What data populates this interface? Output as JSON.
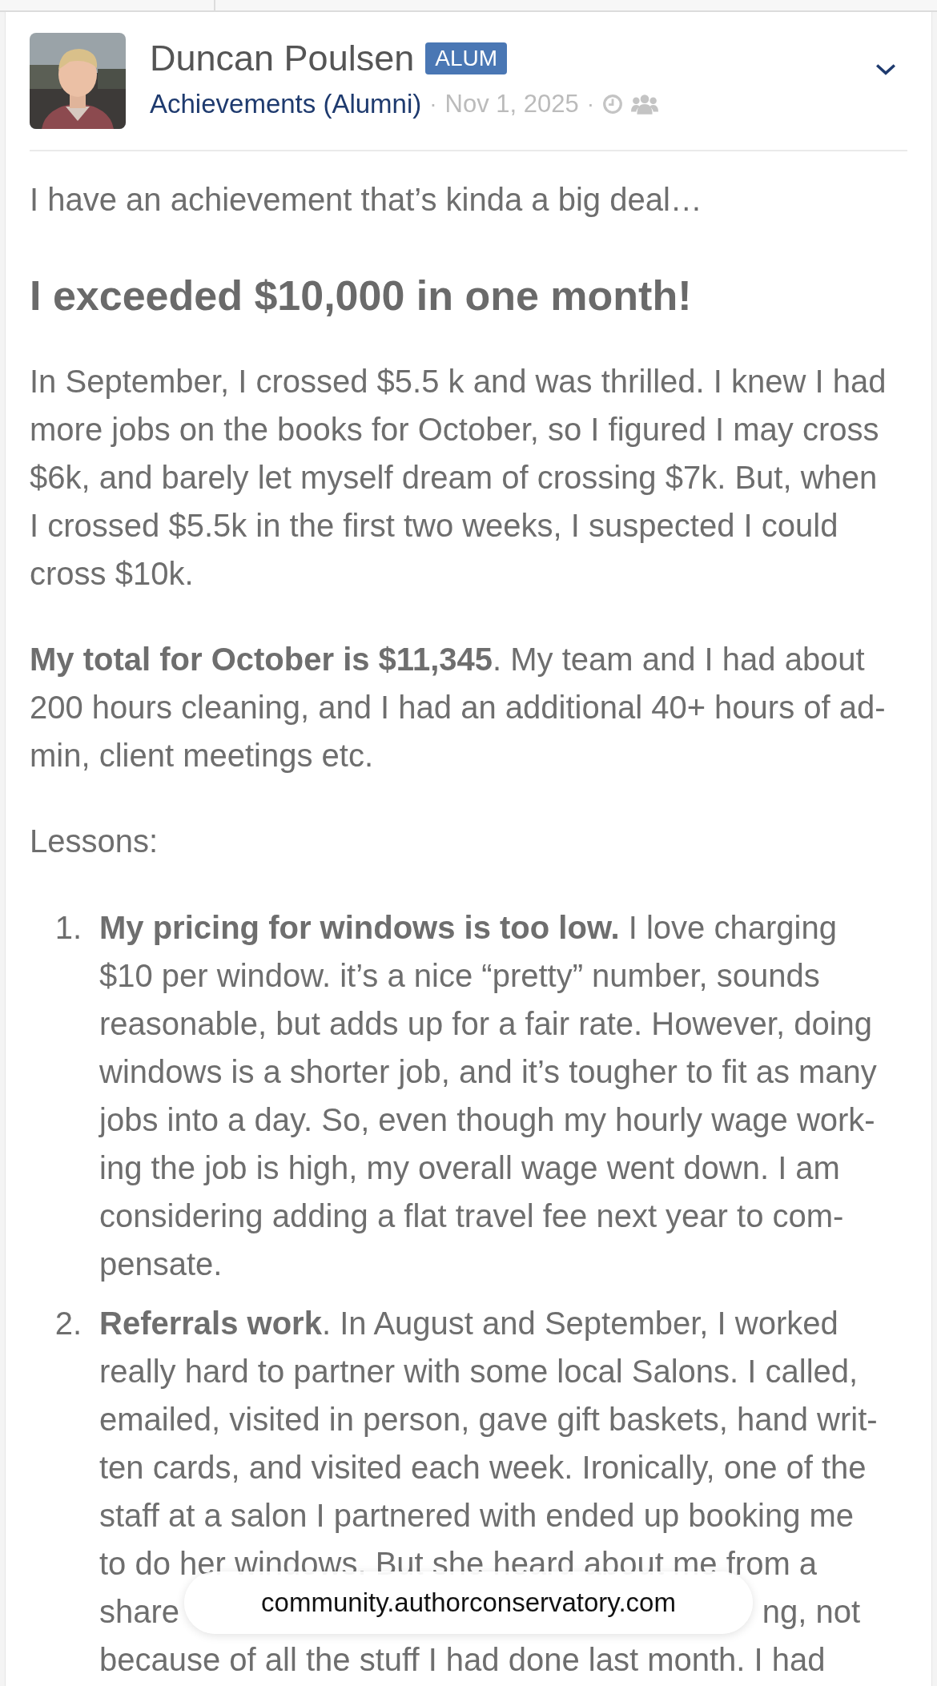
{
  "post": {
    "author": "Duncan Poulsen",
    "badge": "ALUM",
    "category": "Achievements (Alumni)",
    "date": "Nov 1, 2025",
    "intro": "I have an achievement that’s kinda a big deal…",
    "heading": "I exceeded $10,000 in one month!",
    "paragraphs": [
      [
        "In September, I crossed $5.5 k and was thrilled. I knew I had",
        "more jobs on the books for October, so I figured I may cross",
        "$6k, and barely let myself dream of crossing $7k. But, when",
        "I crossed $5.5k in the first two weeks, I suspected I could",
        "cross $10k."
      ],
      [
        "**My total for October is $11,345**. My team and I had about",
        "200 hours cleaning, and I had an additional 40+ hours of ad-",
        "min, client meetings etc."
      ],
      [
        "Lessons:"
      ]
    ],
    "lessons": [
      {
        "number": "1.",
        "lines": [
          "**My pricing for windows is too low.** I love charging",
          "$10 per window. it’s a nice “pretty” number, sounds",
          "reasonable, but adds up for a fair rate. However, doing",
          "windows is a shorter job, and it’s tougher to fit as many",
          "jobs into a day. So, even though my hourly wage work-",
          "ing the job is high, my overall wage went down. I am",
          "considering adding a flat travel fee next year to com-",
          "pensate."
        ]
      },
      {
        "number": "2.",
        "lines": [
          "**Referrals work**. In August and September, I worked",
          "really hard to partner with some local Salons. I called,",
          "emailed, visited in person, gave gift baskets, hand writ-",
          "ten cards, and visited each week. Ironically, one of the",
          "staff at a salon I partnered with ended up booking me",
          "to do her windows. But she heard about me from a",
          {
            "left": "share",
            "right": "ng, not"
          },
          "because of all the stuff I had done last month. I had"
        ]
      }
    ]
  },
  "separators": [
    "·",
    "·"
  ],
  "address_bar": {
    "url": "community.authorconservatory.com"
  }
}
